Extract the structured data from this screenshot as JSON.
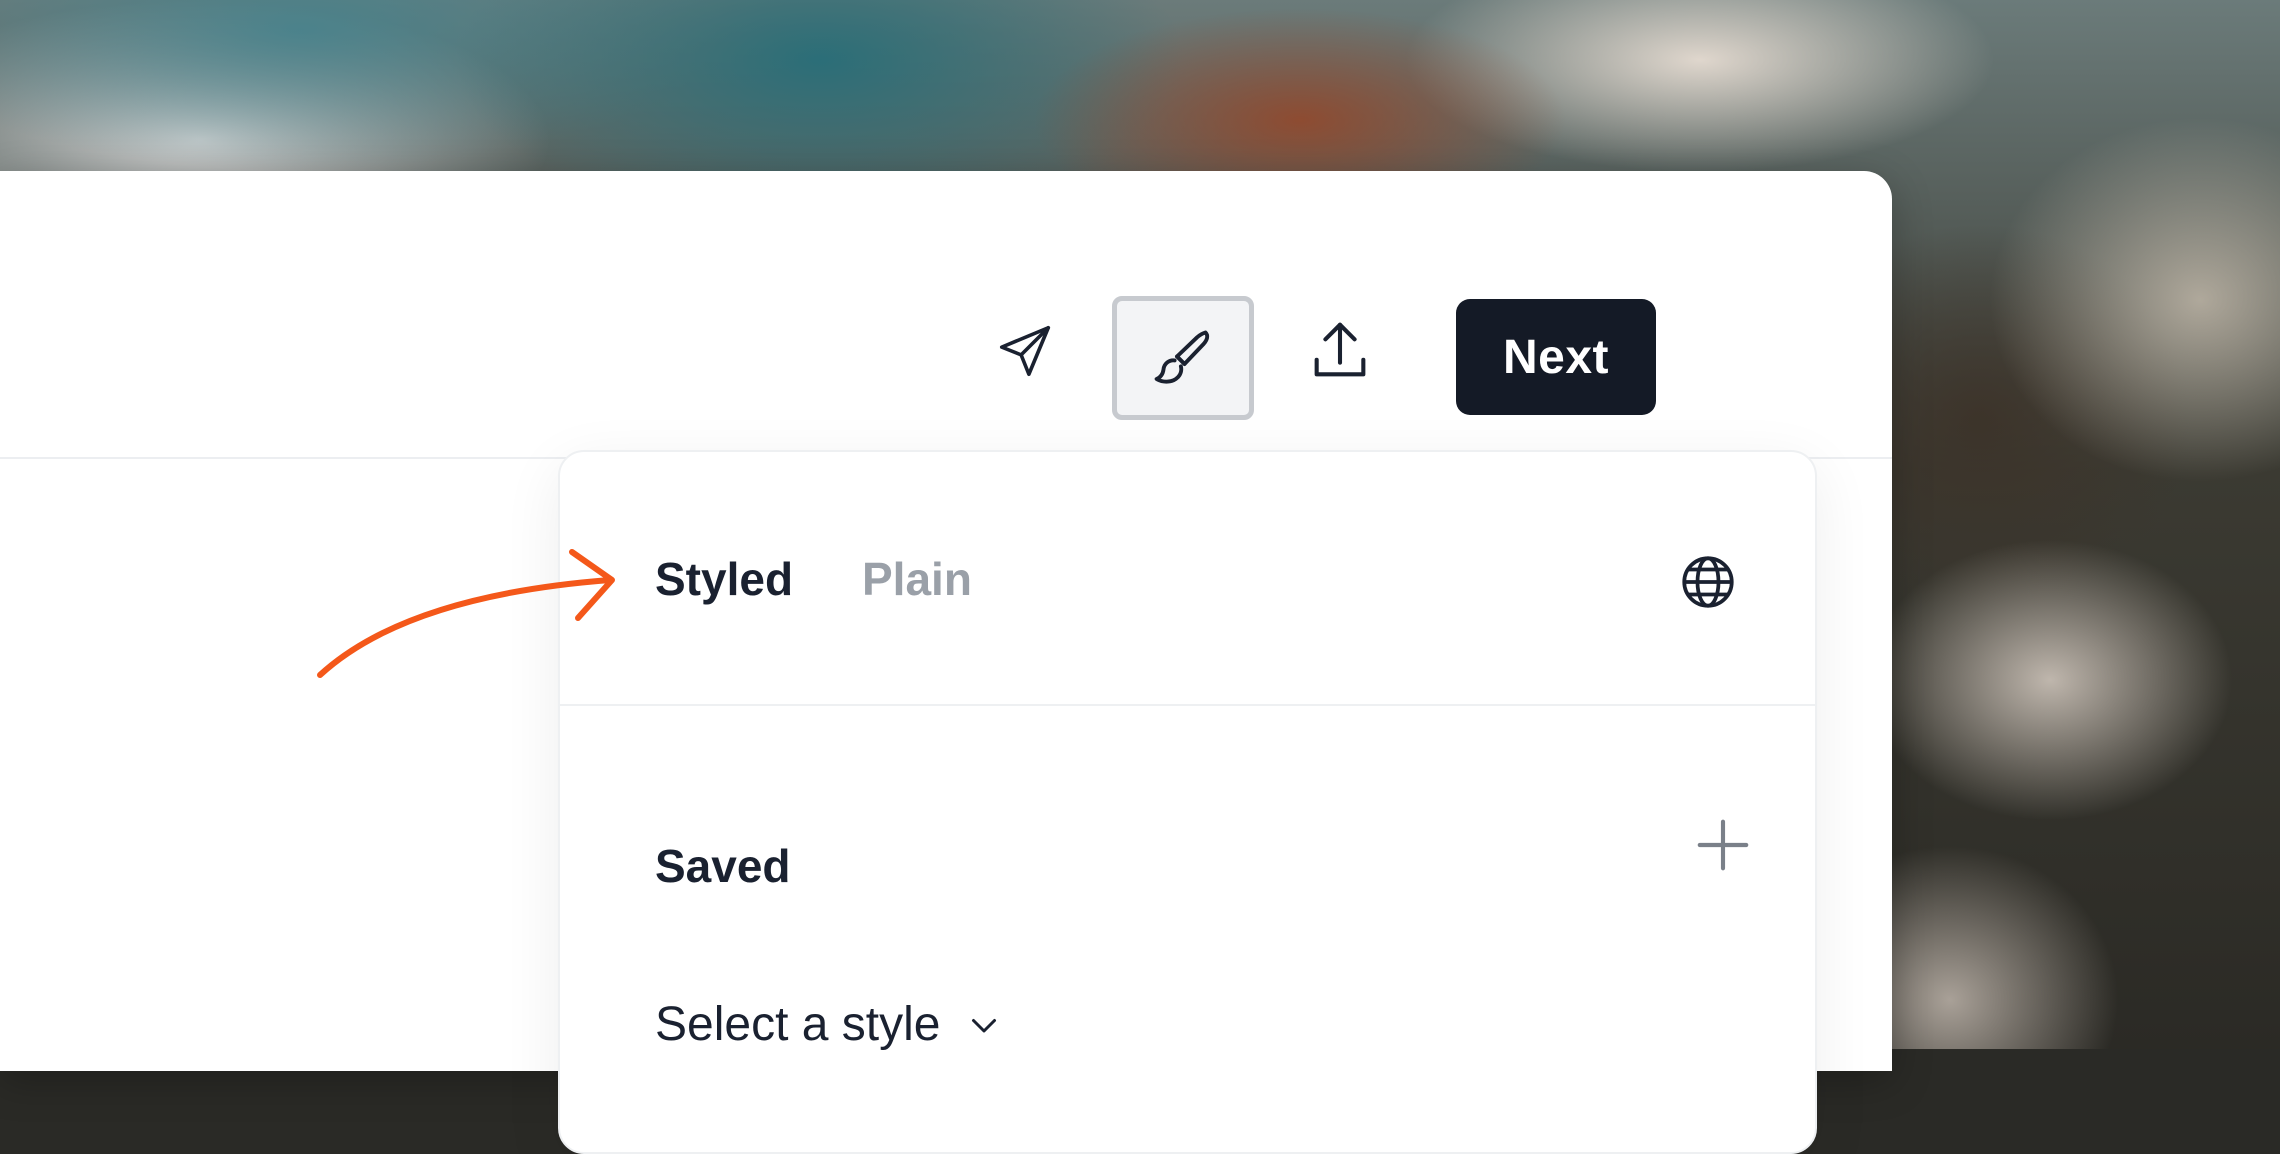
{
  "toolbar": {
    "send_icon": "send-icon",
    "brush_icon": "paintbrush-icon",
    "share_icon": "upload-icon",
    "next_label": "Next"
  },
  "panel": {
    "tabs": [
      {
        "label": "Styled",
        "active": true
      },
      {
        "label": "Plain",
        "active": false
      }
    ],
    "language_icon": "globe-icon",
    "saved_label": "Saved",
    "add_icon": "plus-icon",
    "select_style_label": "Select a style",
    "select_icon": "chevron-down-icon"
  },
  "annotation": {
    "arrow_color": "#f4581a"
  },
  "colors": {
    "primary_button": "#141a26",
    "text": "#1a2130",
    "muted_text": "#9aa0a8"
  }
}
